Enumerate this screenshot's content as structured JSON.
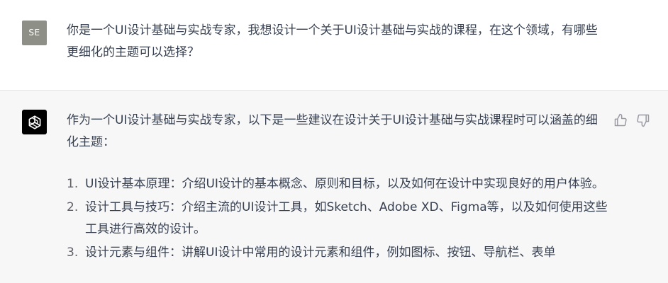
{
  "user": {
    "avatar_initials": "SE",
    "message": "你是一个UI设计基础与实战专家，我想设计一个关于UI设计基础与实战的课程，在这个领域，有哪些更细化的主题可以选择？"
  },
  "assistant": {
    "avatar_icon": "openai-logo-icon",
    "intro": "作为一个UI设计基础与实战专家，以下是一些建议在设计关于UI设计基础与实战课程时可以涵盖的细化主题：",
    "items": [
      {
        "num": "1.",
        "text": "UI设计基本原理：介绍UI设计的基本概念、原则和目标，以及如何在设计中实现良好的用户体验。"
      },
      {
        "num": "2.",
        "text": "设计工具与技巧：介绍主流的UI设计工具，如Sketch、Adobe XD、Figma等，以及如何使用这些工具进行高效的设计。"
      },
      {
        "num": "3.",
        "text": "设计元素与组件：讲解UI设计中常用的设计元素和组件，例如图标、按钮、导航栏、表单"
      }
    ],
    "feedback_icons": [
      "thumbs-up-icon",
      "thumbs-down-icon"
    ]
  },
  "colors": {
    "user_bg": "#ffffff",
    "assistant_bg": "#f7f7f8",
    "user_avatar": "#8e8f86",
    "bot_avatar": "#000000",
    "text": "#374151"
  }
}
